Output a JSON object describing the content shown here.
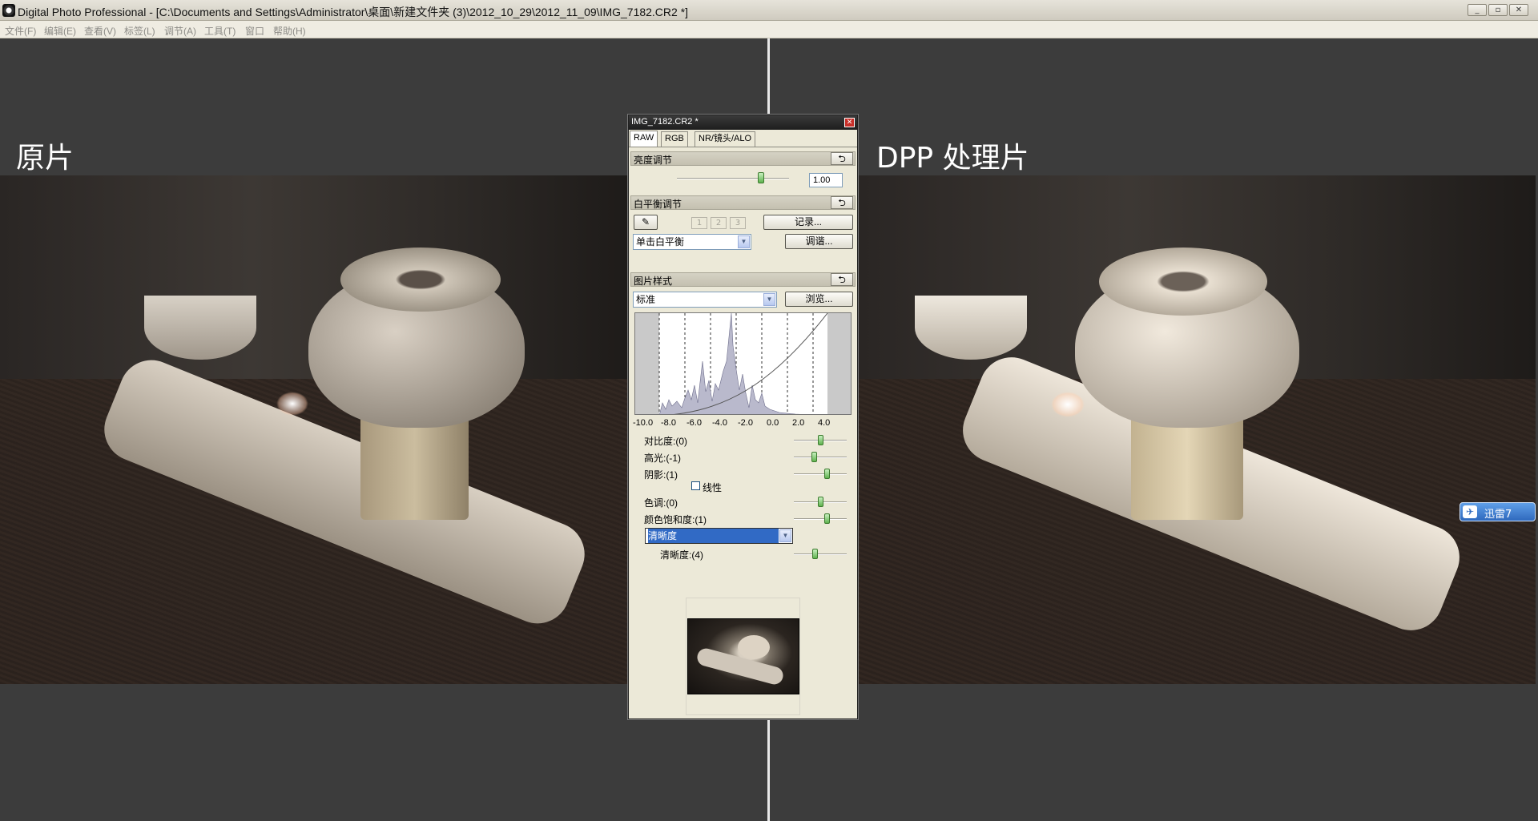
{
  "window": {
    "title": "Digital Photo Professional - [C:\\Documents and Settings\\Administrator\\桌面\\新建文件夹 (3)\\2012_10_29\\2012_11_09\\IMG_7182.CR2 *]",
    "minimize": "_",
    "restore": "▫",
    "close": "✕"
  },
  "menu": {
    "file": "文件(F)",
    "edit": "编辑(E)",
    "view": "查看(V)",
    "label": "标签(L)",
    "adjust": "调节(A)",
    "tools": "工具(T)",
    "window": "窗口",
    "help": "帮助(H)"
  },
  "panes": {
    "left_label": "原片",
    "right_label": "DPP 处理片"
  },
  "palette": {
    "title": "IMG_7182.CR2 *",
    "close": "✕",
    "tabs": [
      "RAW",
      "RGB",
      "NR/镜头/ALO"
    ],
    "brightness": {
      "header": "亮度调节",
      "value": "1.00",
      "level": 0.75
    },
    "white_balance": {
      "header": "白平衡调节",
      "slots": [
        "1",
        "2",
        "3"
      ],
      "register_button": "记录...",
      "mode": "单击白平衡",
      "tune_button": "调谐..."
    },
    "picture_style": {
      "header": "图片样式",
      "style": "标准",
      "browse_button": "浏览...",
      "histogram_ticks": [
        "-10.0",
        "-8.0",
        "-6.0",
        "-4.0",
        "-2.0",
        "0.0",
        "2.0",
        "4.0"
      ],
      "params": [
        {
          "label": "对比度:(0)",
          "level": 0.5
        },
        {
          "label": "高光:(-1)",
          "level": 0.38
        },
        {
          "label": "阴影:(1)",
          "level": 0.62
        }
      ],
      "linear_label": "线性",
      "params2": [
        {
          "label": "色调:(0)",
          "level": 0.5
        },
        {
          "label": "颜色饱和度:(1)",
          "level": 0.62
        }
      ],
      "sharpness_mode": "清晰度",
      "sharpness": {
        "label": "清晰度:(4)",
        "level": 0.4
      }
    },
    "reset_icon": "⮌"
  },
  "taskbar_float": {
    "icon": "✈",
    "label": "迅雷7"
  }
}
